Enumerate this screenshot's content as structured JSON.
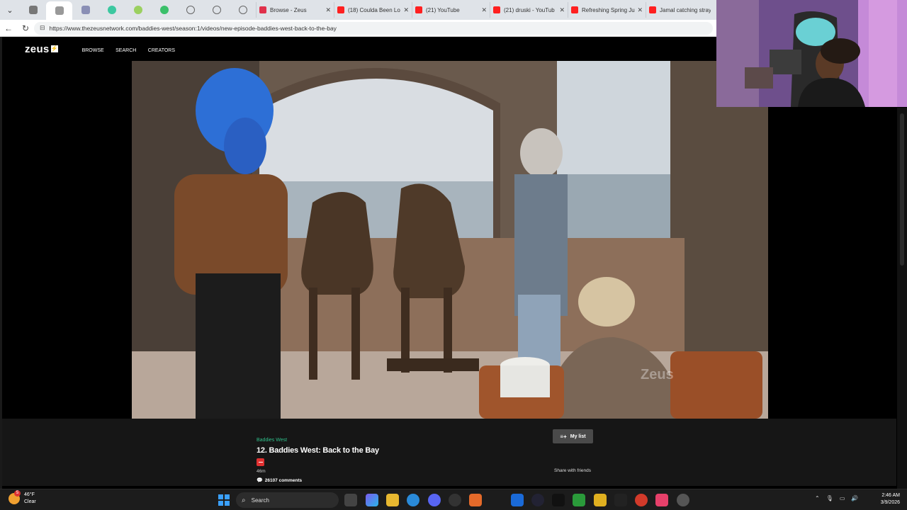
{
  "browser": {
    "tabs": [
      {
        "title": "Browse - Zeus",
        "color": "#e0314b"
      },
      {
        "title": "(18) Coulda Been Lo",
        "color": "#ff2020"
      },
      {
        "title": "(21) YouTube",
        "color": "#ff2020"
      },
      {
        "title": "(21) druski - YouTub",
        "color": "#ff2020"
      },
      {
        "title": "Refreshing Spring Ju",
        "color": "#ff2020"
      },
      {
        "title": "Jamal catching stray",
        "color": "#ff2020"
      }
    ],
    "close_glyph": "✕",
    "url": "https://www.thezeusnetwork.com/baddies-west/season:1/videos/new-episode-baddies-west-back-to-the-bay"
  },
  "site": {
    "logo": "zeus",
    "nav": [
      "BROWSE",
      "SEARCH",
      "CREATORS"
    ]
  },
  "video": {
    "watermark": "Zeus"
  },
  "episode": {
    "show": "Baddies West",
    "title": "12. Baddies West: Back to the Bay",
    "duration": "46m",
    "comments": "26107 comments",
    "my_list_label": "My list",
    "share_label": "Share with friends"
  },
  "taskbar": {
    "weather_temp": "46°F",
    "weather_cond": "Clear",
    "weather_badge": "5",
    "search_placeholder": "Search",
    "time": "2:46 AM",
    "date": "3/9/2026"
  },
  "colors": {
    "accent_green": "#2fbf8a",
    "rating_red": "#e03131"
  }
}
